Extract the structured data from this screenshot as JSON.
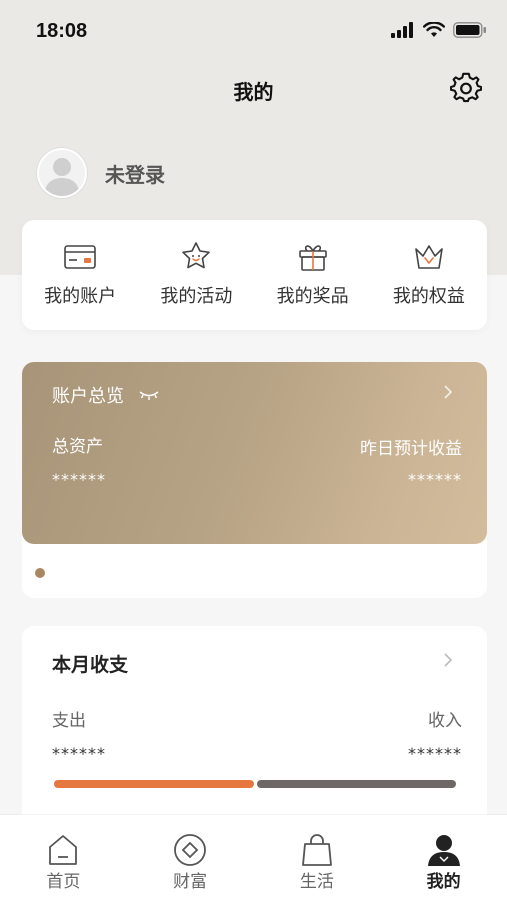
{
  "status_bar": {
    "time": "18:08"
  },
  "header": {
    "title": "我的",
    "settings_icon": "gear-icon"
  },
  "profile": {
    "login_text": "未登录",
    "avatar_icon": "person-avatar-icon"
  },
  "quick_actions": [
    {
      "label": "我的账户",
      "icon": "card-icon"
    },
    {
      "label": "我的活动",
      "icon": "star-face-icon"
    },
    {
      "label": "我的奖品",
      "icon": "gift-icon"
    },
    {
      "label": "我的权益",
      "icon": "crown-icon"
    }
  ],
  "overview": {
    "title": "账户总览",
    "total_assets_label": "总资产",
    "total_assets_value": "******",
    "yesterday_income_label": "昨日预计收益",
    "yesterday_income_value": "******",
    "colors": {
      "card_start": "#a89478",
      "card_end": "#d2bc9c",
      "dot": "#a88862"
    }
  },
  "monthly": {
    "title": "本月收支",
    "expense_label": "支出",
    "expense_value": "******",
    "income_label": "收入",
    "income_value": "******",
    "expense_share": 0.5,
    "colors": {
      "expense": "#e6773f",
      "income": "#6e6766"
    }
  },
  "tab_bar": [
    {
      "label": "首页",
      "icon": "home-icon",
      "active": false
    },
    {
      "label": "财富",
      "icon": "wealth-icon",
      "active": false
    },
    {
      "label": "生活",
      "icon": "shopping-bag-icon",
      "active": false
    },
    {
      "label": "我的",
      "icon": "person-icon",
      "active": true
    }
  ]
}
